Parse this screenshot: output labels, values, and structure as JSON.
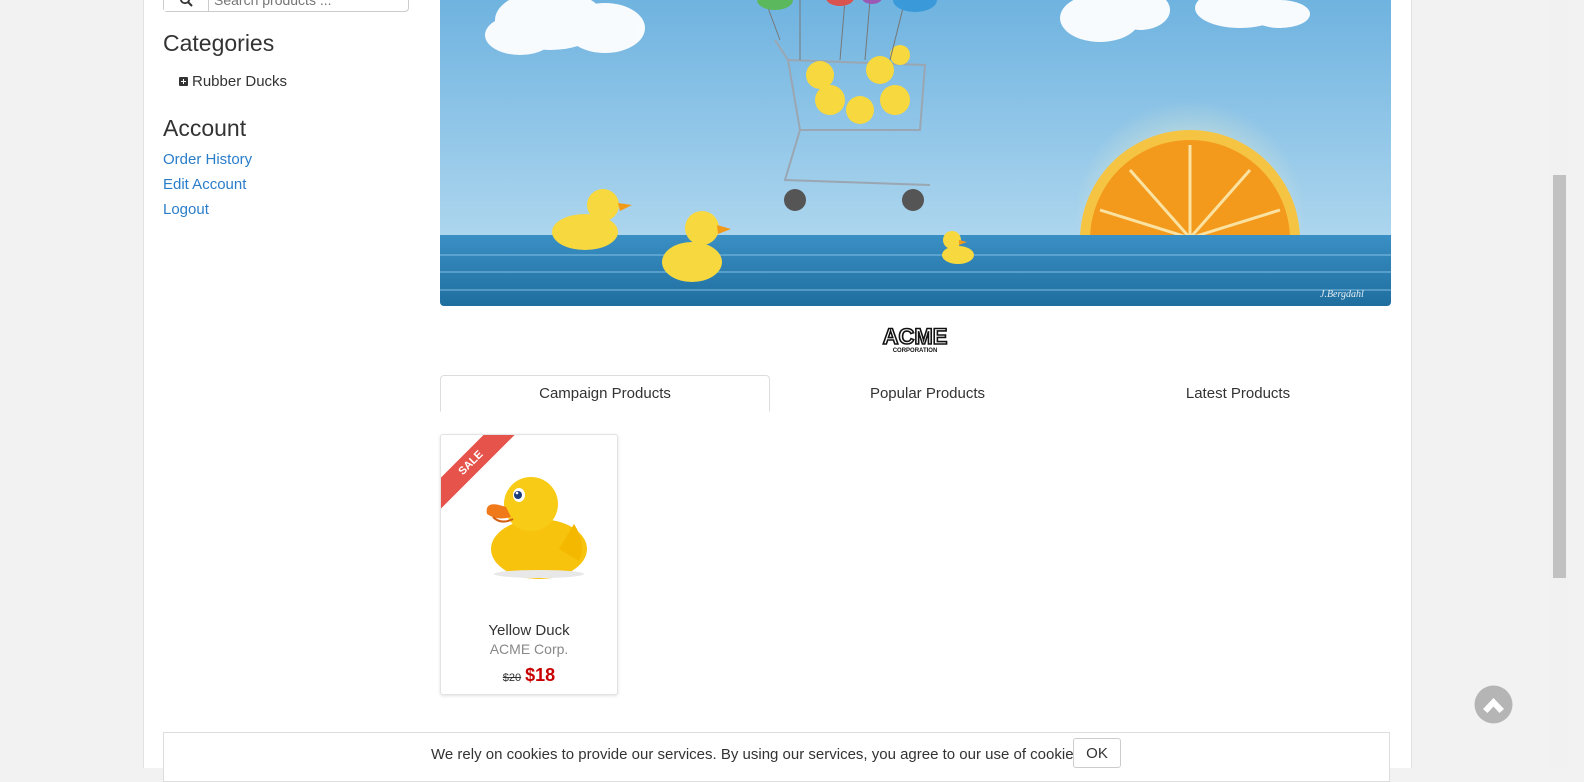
{
  "search": {
    "placeholder": "Search products ..."
  },
  "sidebar": {
    "categories_title": "Categories",
    "categories": [
      {
        "label": "Rubber Ducks"
      }
    ],
    "account_title": "Account",
    "account_links": [
      "Order History",
      "Edit Account",
      "Logout"
    ]
  },
  "banner": {
    "signature": "J.Bergdahl"
  },
  "logo": {
    "text": "ACME",
    "sub": "CORPORATION"
  },
  "tabs": [
    {
      "label": "Campaign Products",
      "active": true
    },
    {
      "label": "Popular Products",
      "active": false
    },
    {
      "label": "Latest Products",
      "active": false
    }
  ],
  "products": [
    {
      "badge": "SALE",
      "name": "Yellow Duck",
      "brand": "ACME Corp.",
      "regular_price": "$20",
      "campaign_price": "$18"
    }
  ],
  "cookie": {
    "text": "We rely on cookies to provide our services. By using our services, you agree to our use of cookies.",
    "ok_label": "OK"
  },
  "colors": {
    "link": "#2a7dc9",
    "sale": "#e5534b",
    "price": "#c80000"
  }
}
